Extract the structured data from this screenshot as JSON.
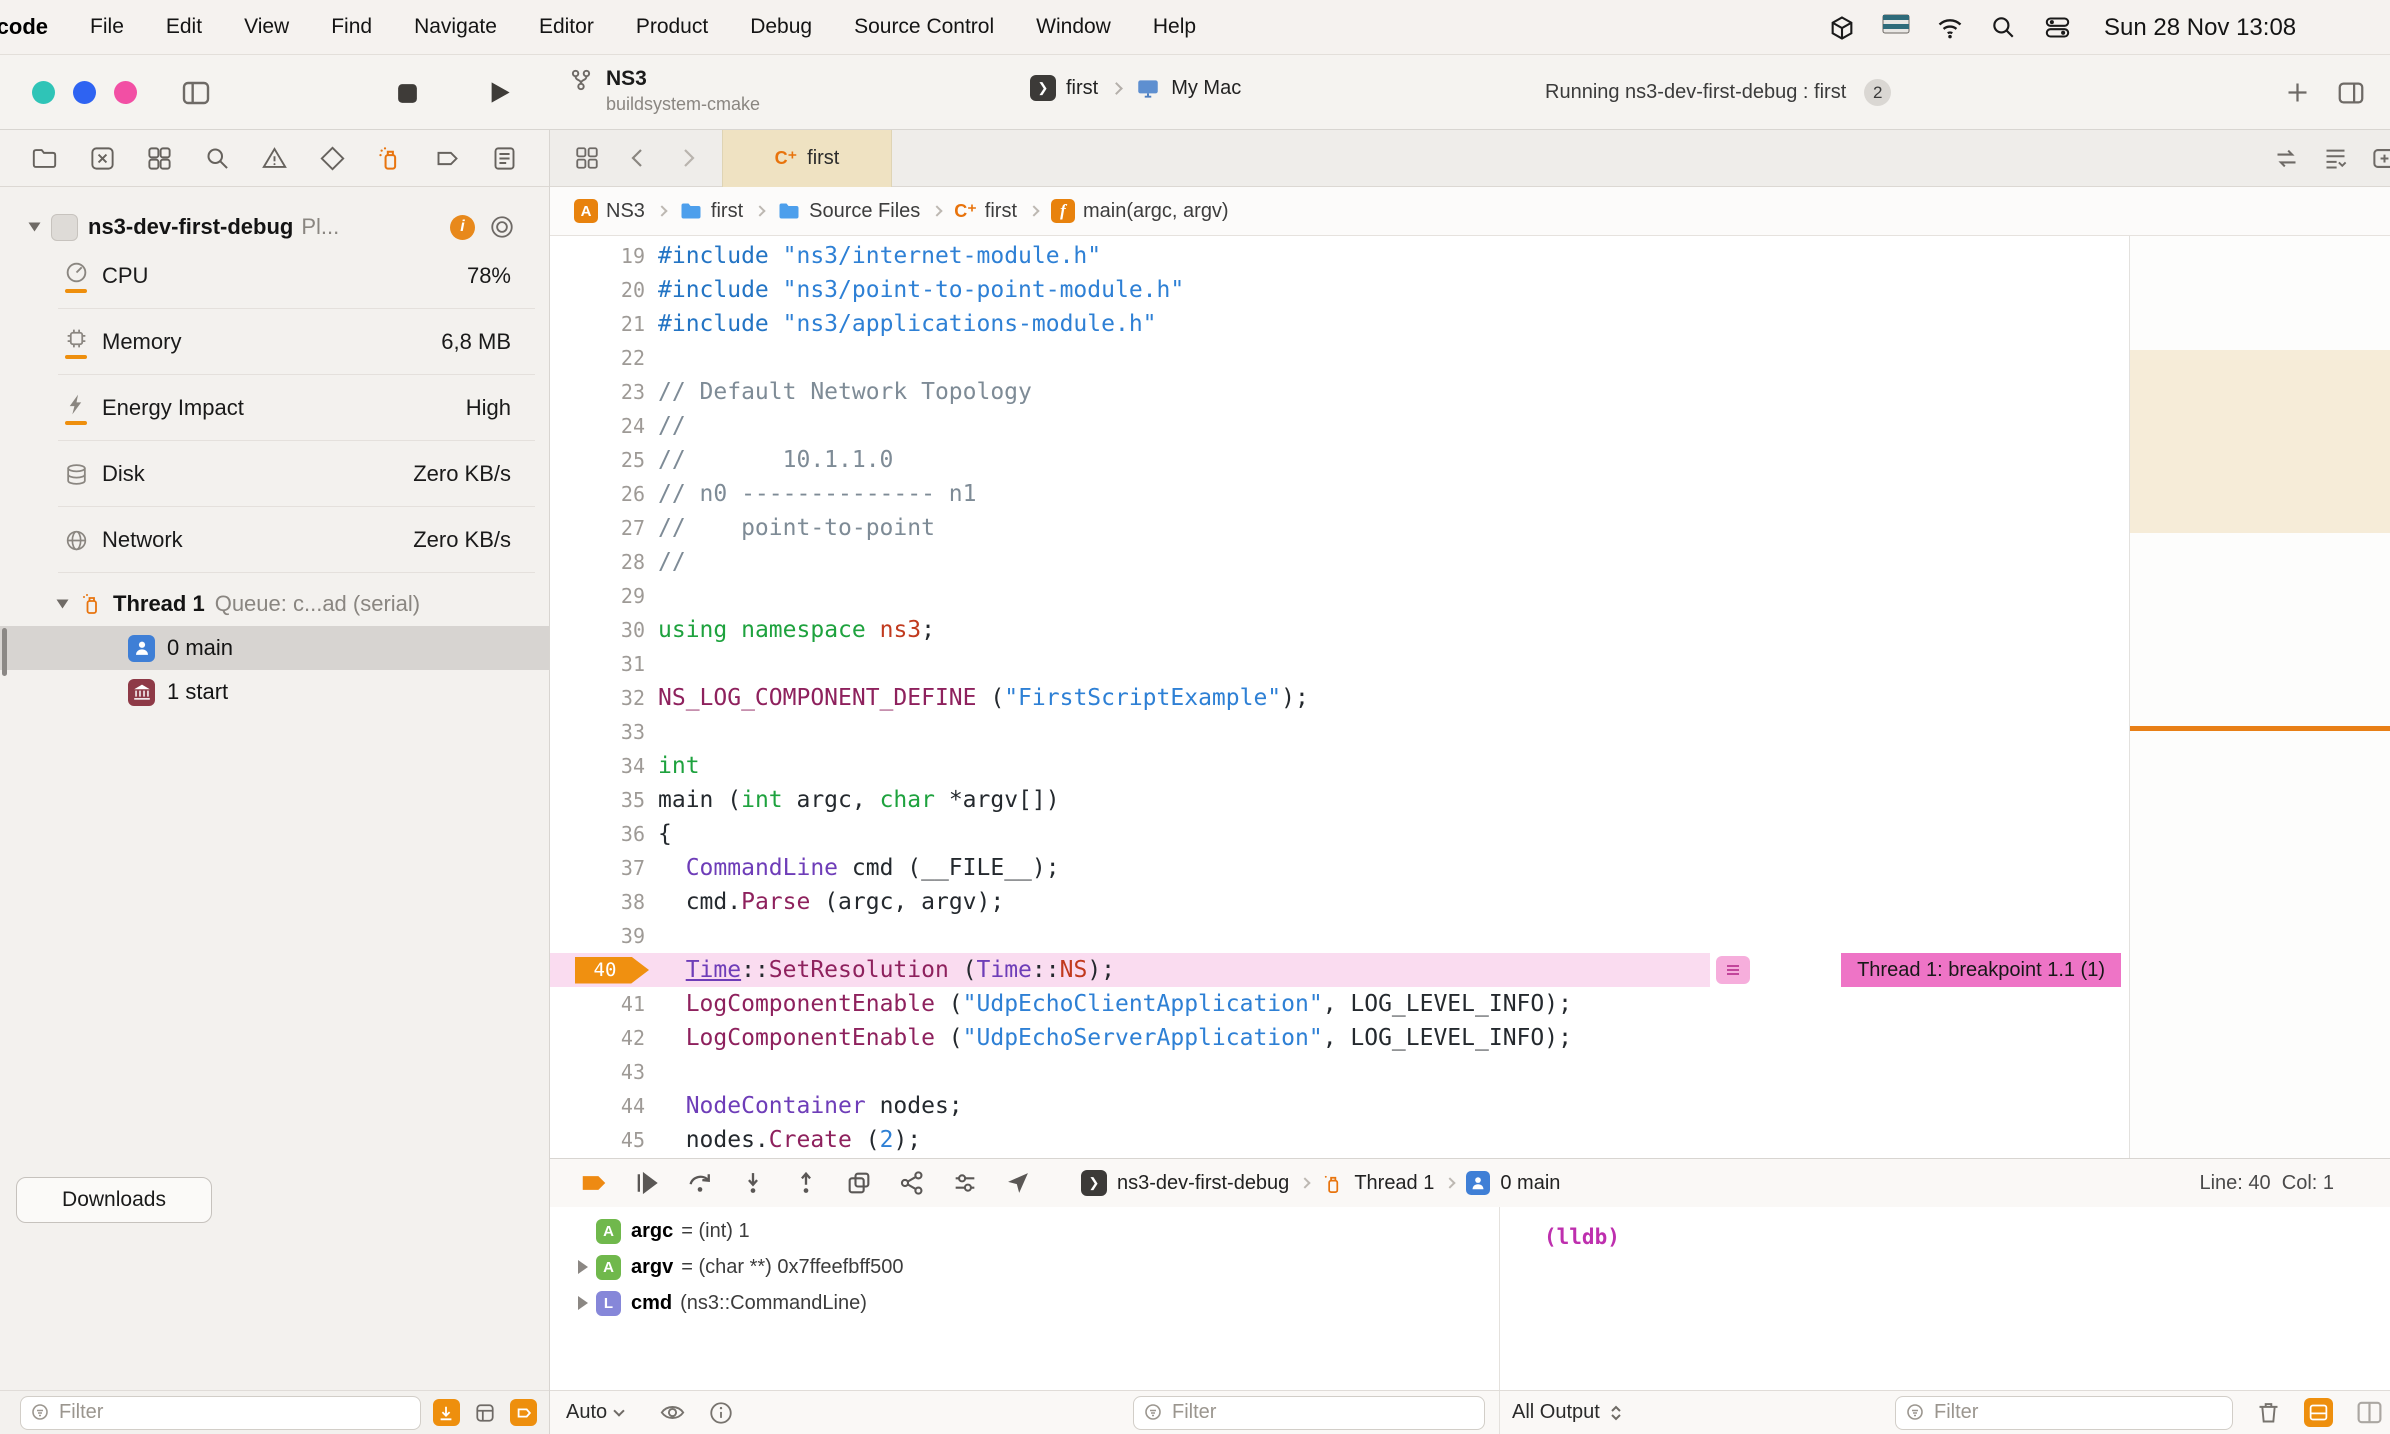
{
  "menu_bar": {
    "app_name": "Xcode",
    "items": [
      "File",
      "Edit",
      "View",
      "Find",
      "Navigate",
      "Editor",
      "Product",
      "Debug",
      "Source Control",
      "Window",
      "Help"
    ],
    "clock": "Sun 28 Nov 13:08"
  },
  "toolbar": {
    "project_name": "NS3",
    "project_subtitle": "buildsystem-cmake",
    "scheme_name": "first",
    "destination": "My Mac",
    "status_text": "Running ns3-dev-first-debug : first",
    "status_badge": "2"
  },
  "sidebar": {
    "process_name": "ns3-dev-first-debug",
    "process_suffix": "Pl...",
    "gauges": [
      {
        "label": "CPU",
        "value": "78%"
      },
      {
        "label": "Memory",
        "value": "6,8 MB"
      },
      {
        "label": "Energy Impact",
        "value": "High"
      },
      {
        "label": "Disk",
        "value": "Zero KB/s"
      },
      {
        "label": "Network",
        "value": "Zero KB/s"
      }
    ],
    "thread_name": "Thread 1",
    "thread_detail": "Queue: c...ad (serial)",
    "frames": [
      {
        "label": "0 main"
      },
      {
        "label": "1 start"
      }
    ],
    "downloads_label": "Downloads",
    "filter_placeholder": "Filter"
  },
  "editor": {
    "tab_label": "first",
    "breadcrumbs": [
      "NS3",
      "first",
      "Source Files",
      "first",
      "main(argc, argv)"
    ],
    "breakpoint_label": "Thread 1: breakpoint 1.1 (1)",
    "line_col": "Line: 40  Col: 1",
    "code": [
      {
        "n": 19,
        "t": [
          [
            "i",
            "#include"
          ],
          [
            "p",
            " "
          ],
          [
            "s",
            "\"ns3/internet-module.h\""
          ]
        ]
      },
      {
        "n": 20,
        "t": [
          [
            "i",
            "#include"
          ],
          [
            "p",
            " "
          ],
          [
            "s",
            "\"ns3/point-to-point-module.h\""
          ]
        ]
      },
      {
        "n": 21,
        "t": [
          [
            "i",
            "#include"
          ],
          [
            "p",
            " "
          ],
          [
            "s",
            "\"ns3/applications-module.h\""
          ]
        ]
      },
      {
        "n": 22,
        "t": []
      },
      {
        "n": 23,
        "t": [
          [
            "c",
            "// Default Network Topology"
          ]
        ]
      },
      {
        "n": 24,
        "t": [
          [
            "c",
            "//"
          ]
        ]
      },
      {
        "n": 25,
        "t": [
          [
            "c",
            "//       10.1.1.0"
          ]
        ]
      },
      {
        "n": 26,
        "t": [
          [
            "c",
            "// n0 -------------- n1"
          ]
        ]
      },
      {
        "n": 27,
        "t": [
          [
            "c",
            "//    point-to-point"
          ]
        ]
      },
      {
        "n": 28,
        "t": [
          [
            "c",
            "//"
          ]
        ]
      },
      {
        "n": 29,
        "t": []
      },
      {
        "n": 30,
        "t": [
          [
            "k",
            "using"
          ],
          [
            "p",
            " "
          ],
          [
            "k",
            "namespace"
          ],
          [
            "p",
            " "
          ],
          [
            "r",
            "ns3"
          ],
          [
            "p",
            ";"
          ]
        ]
      },
      {
        "n": 31,
        "t": []
      },
      {
        "n": 32,
        "t": [
          [
            "f",
            "NS_LOG_COMPONENT_DEFINE"
          ],
          [
            "p",
            " ("
          ],
          [
            "s",
            "\"FirstScriptExample\""
          ],
          [
            "p",
            ");"
          ]
        ]
      },
      {
        "n": 33,
        "t": []
      },
      {
        "n": 34,
        "t": [
          [
            "k",
            "int"
          ]
        ]
      },
      {
        "n": 35,
        "t": [
          [
            "p",
            "main ("
          ],
          [
            "k",
            "int"
          ],
          [
            "p",
            " argc, "
          ],
          [
            "k",
            "char"
          ],
          [
            "p",
            " *argv[])"
          ]
        ]
      },
      {
        "n": 36,
        "t": [
          [
            "p",
            "{"
          ]
        ]
      },
      {
        "n": 37,
        "t": [
          [
            "p",
            "  "
          ],
          [
            "t",
            "CommandLine"
          ],
          [
            "p",
            " cmd (__FILE__);"
          ]
        ]
      },
      {
        "n": 38,
        "t": [
          [
            "p",
            "  cmd."
          ],
          [
            "f",
            "Parse"
          ],
          [
            "p",
            " (argc, argv);"
          ]
        ]
      },
      {
        "n": 39,
        "t": []
      },
      {
        "n": 40,
        "bp": true,
        "t": [
          [
            "p",
            "  "
          ],
          [
            "tu",
            "Time"
          ],
          [
            "p",
            "::"
          ],
          [
            "f",
            "SetResolution"
          ],
          [
            "p",
            " ("
          ],
          [
            "t",
            "Time"
          ],
          [
            "p",
            "::"
          ],
          [
            "r",
            "NS"
          ],
          [
            "p",
            ");"
          ]
        ]
      },
      {
        "n": 41,
        "t": [
          [
            "p",
            "  "
          ],
          [
            "f",
            "LogComponentEnable"
          ],
          [
            "p",
            " ("
          ],
          [
            "s",
            "\"UdpEchoClientApplication\""
          ],
          [
            "p",
            ", LOG_LEVEL_INFO);"
          ]
        ]
      },
      {
        "n": 42,
        "t": [
          [
            "p",
            "  "
          ],
          [
            "f",
            "LogComponentEnable"
          ],
          [
            "p",
            " ("
          ],
          [
            "s",
            "\"UdpEchoServerApplication\""
          ],
          [
            "p",
            ", LOG_LEVEL_INFO);"
          ]
        ]
      },
      {
        "n": 43,
        "t": []
      },
      {
        "n": 44,
        "t": [
          [
            "p",
            "  "
          ],
          [
            "t",
            "NodeContainer"
          ],
          [
            "p",
            " nodes;"
          ]
        ]
      },
      {
        "n": 45,
        "t": [
          [
            "p",
            "  nodes."
          ],
          [
            "f",
            "Create"
          ],
          [
            "p",
            " ("
          ],
          [
            "n2",
            "2"
          ],
          [
            "p",
            ");"
          ]
        ]
      }
    ]
  },
  "debug_bar": {
    "crumb_process": "ns3-dev-first-debug",
    "crumb_thread": "Thread 1",
    "crumb_frame": "0 main"
  },
  "variables": {
    "rows": [
      {
        "badge": "A",
        "name": "argc",
        "detail": "= (int) 1"
      },
      {
        "badge": "A",
        "name": "argv",
        "detail": "= (char **) 0x7ffeefbff500"
      },
      {
        "badge": "L",
        "name": "cmd",
        "detail": "(ns3::CommandLine)"
      }
    ],
    "scope_label": "Auto",
    "filter_placeholder": "Filter"
  },
  "console": {
    "prompt": "(lldb)",
    "output_mode": "All Output",
    "filter_placeholder": "Filter"
  }
}
